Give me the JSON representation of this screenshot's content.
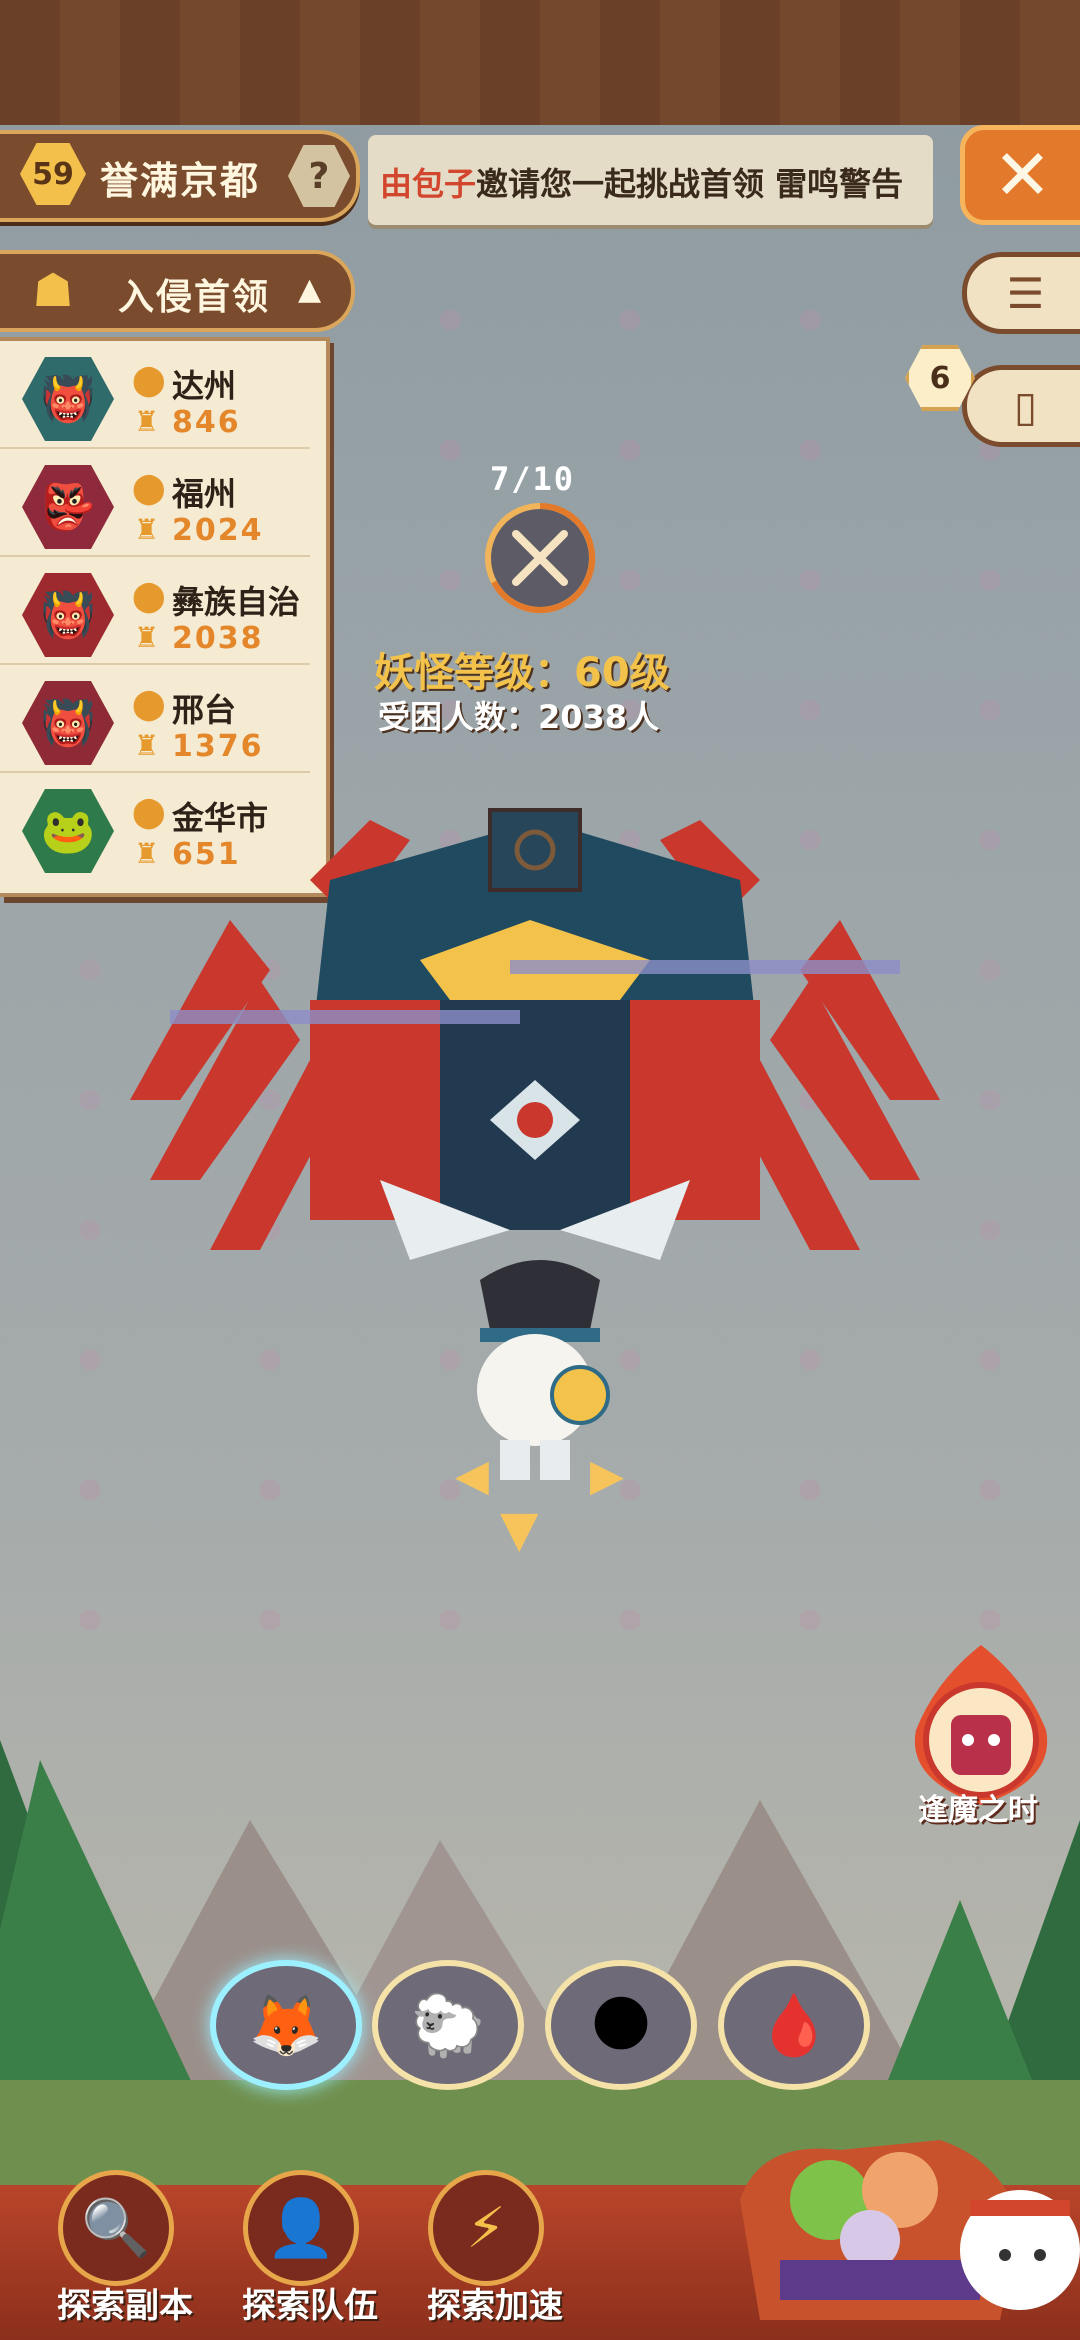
{
  "top_bar": {
    "level": "59",
    "region_name": "誉满京都",
    "help_label": "?",
    "ticker_player": "由包子",
    "ticker_message": "邀请您一起挑战首领 雷鸣警告",
    "close_label": "✕"
  },
  "side_buttons": {
    "log_icon": "☰",
    "card_icon": "▯",
    "card_count": "6"
  },
  "boss_list": {
    "header": "入侵首领",
    "caret": "▲",
    "items": [
      {
        "city": "达州",
        "score": "846",
        "color": "#2f6b6a"
      },
      {
        "city": "福州",
        "score": "2024",
        "color": "#8e2a3b"
      },
      {
        "city": "彝族自治",
        "score": "2038",
        "color": "#9c2a2f"
      },
      {
        "city": "邢台",
        "score": "1376",
        "color": "#8d2a35"
      },
      {
        "city": "金华市",
        "score": "651",
        "color": "#2f7a4a"
      }
    ]
  },
  "boss_info": {
    "progress": "7/10",
    "monster_level": "妖怪等级：60级",
    "victims": "受困人数：2038人"
  },
  "event": {
    "label": "逢魔之时"
  },
  "team": {
    "slots": [
      "🦊",
      "🐑",
      "🌑",
      "🩸"
    ],
    "active_index": 0
  },
  "bottom_nav": {
    "items": [
      {
        "label": "探索副本",
        "icon": "🔍"
      },
      {
        "label": "探索队伍",
        "icon": "👤"
      },
      {
        "label": "探索加速",
        "icon": "⚡"
      }
    ]
  },
  "colors": {
    "accent": "#e37a2b",
    "wood": "#7a4b2c",
    "gold": "#f2c24a"
  }
}
